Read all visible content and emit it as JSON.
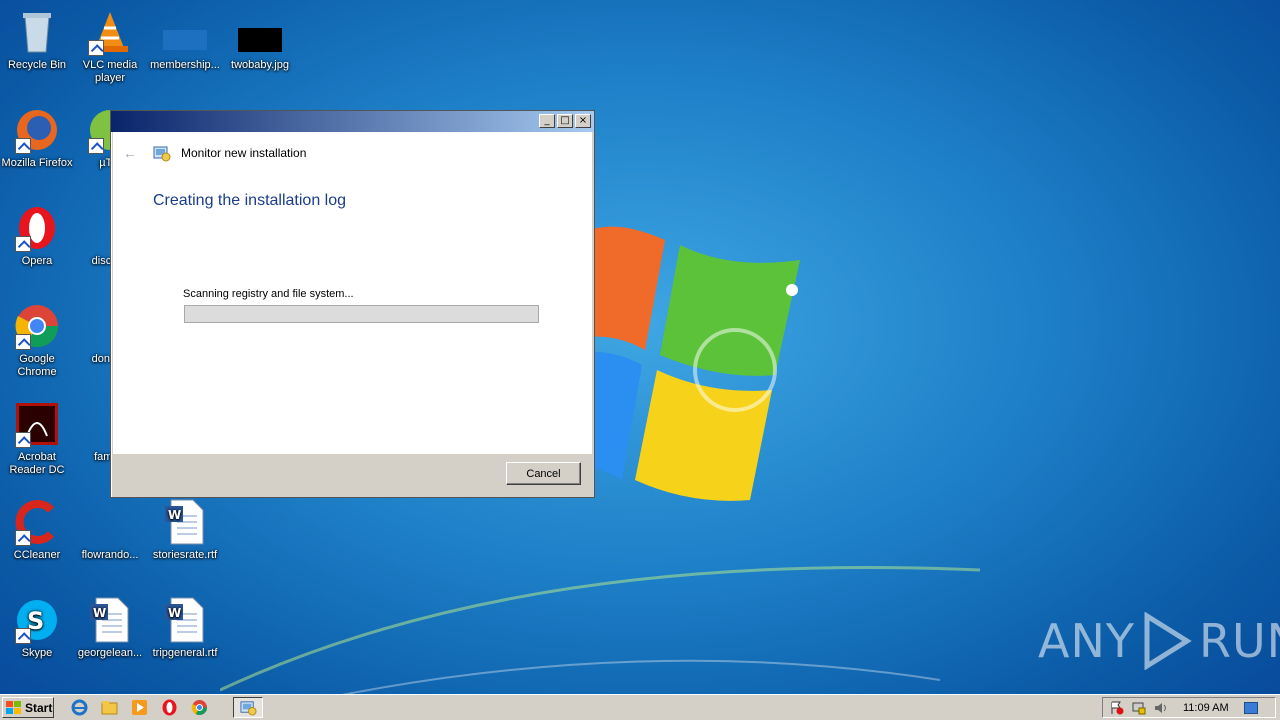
{
  "desktop": {
    "icons": [
      {
        "label": "Recycle Bin"
      },
      {
        "label": "VLC media player"
      },
      {
        "label": "membership..."
      },
      {
        "label": "twobaby.jpg"
      },
      {
        "label": "Mozilla Firefox"
      },
      {
        "label": "µTor"
      },
      {
        "label": "Opera"
      },
      {
        "label": "discuss"
      },
      {
        "label": "Google Chrome"
      },
      {
        "label": "donepe"
      },
      {
        "label": "Acrobat Reader DC"
      },
      {
        "label": "familie"
      },
      {
        "label": "CCleaner"
      },
      {
        "label": "flowrando..."
      },
      {
        "label": "storiesrate.rtf"
      },
      {
        "label": "Skype"
      },
      {
        "label": "georgelean..."
      },
      {
        "label": "tripgeneral.rtf"
      }
    ],
    "watermark": {
      "left": "ANY",
      "right": "RUN"
    }
  },
  "dialog": {
    "title_controls": {
      "minimize": "_",
      "maximize": "□",
      "close": "×"
    },
    "nav_back": "←",
    "nav_title": "Monitor new installation",
    "heading": "Creating the installation log",
    "status_text": "Scanning registry and file system...",
    "progress": 0,
    "cancel_label": "Cancel"
  },
  "taskbar": {
    "start_label": "Start",
    "tray_up": "⌃",
    "clock": "11:09 AM"
  },
  "colors": {
    "heading": "#1a3e8c",
    "titlebar_start": "#0a246a",
    "titlebar_end": "#a6caf0"
  }
}
